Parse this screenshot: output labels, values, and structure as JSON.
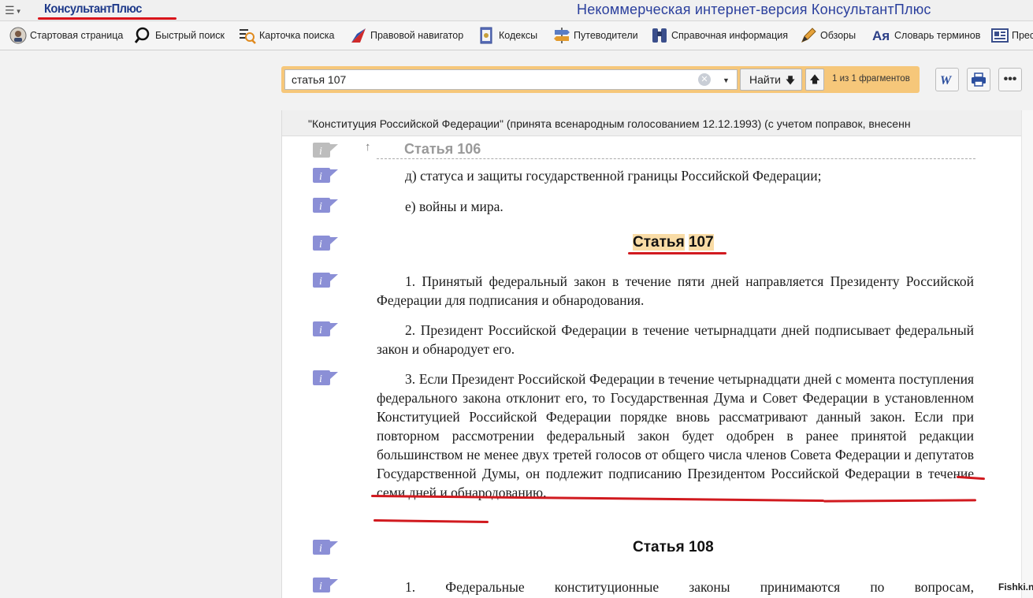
{
  "app": {
    "logo": "КонсультантПлюс",
    "title": "Некоммерческая интернет-версия КонсультантПлюс"
  },
  "toolbar": {
    "items": [
      {
        "label": "Стартовая страница",
        "icon": "start-page-icon"
      },
      {
        "label": "Быстрый поиск",
        "icon": "magnifier-icon"
      },
      {
        "label": "Карточка поиска",
        "icon": "search-card-icon"
      },
      {
        "label": "Правовой навигатор",
        "icon": "navigator-icon"
      },
      {
        "label": "Кодексы",
        "icon": "codex-icon"
      },
      {
        "label": "Путеводители",
        "icon": "signpost-icon"
      },
      {
        "label": "Справочная информация",
        "icon": "binoculars-icon"
      },
      {
        "label": "Обзоры",
        "icon": "pen-icon"
      },
      {
        "label": "Словарь терминов",
        "icon": "dictionary-icon"
      },
      {
        "label": "Прес",
        "icon": "newspaper-icon"
      }
    ]
  },
  "search": {
    "query": "статья 107",
    "find_label": "Найти",
    "fragments": "1 из 1 фрагментов"
  },
  "document": {
    "header": "\"Конституция Российской Федерации\" (принята всенародным голосованием 12.12.1993) (с учетом поправок, внесенн",
    "prev_article": "Статья 106",
    "item_d": "д) статуса и защиты государственной границы Российской Федерации;",
    "item_e": "е) войны и мира.",
    "article_word": "Статья",
    "article_num": "107",
    "p1": "1. Принятый федеральный закон в течение пяти дней направляется Президенту Российской Федерации для подписания и обнародования.",
    "p2": "2. Президент Российской Федерации в течение четырнадцати дней подписывает федеральный закон и обнародует его.",
    "p3": "3. Если Президент Российской Федерации в течение четырнадцати дней с момента поступления федерального закона отклонит его, то Государственная Дума и Совет Федерации в установленном Конституцией Российской Федерации порядке вновь рассматривают данный закон. Если при повторном рассмотрении федеральный закон будет одобрен в ранее принятой редакции большинством не менее двух третей голосов от общего числа членов Совета Федерации и депутатов Государственной Думы, он подлежит подписанию Президентом Российской Федерации в течение семи дней и обнародованию.",
    "next_article": "Статья 108",
    "p108": "1. Федеральные конституционные законы принимаются по вопросам,"
  },
  "watermark": "Fishki.net",
  "colors": {
    "logo": "#1f3a8a",
    "title": "#2a3f9d",
    "search_bar": "#f6c77a",
    "highlight": "#f9dca6",
    "annotation_red": "#d11a1f",
    "info_icon": "#8b8fd6"
  }
}
